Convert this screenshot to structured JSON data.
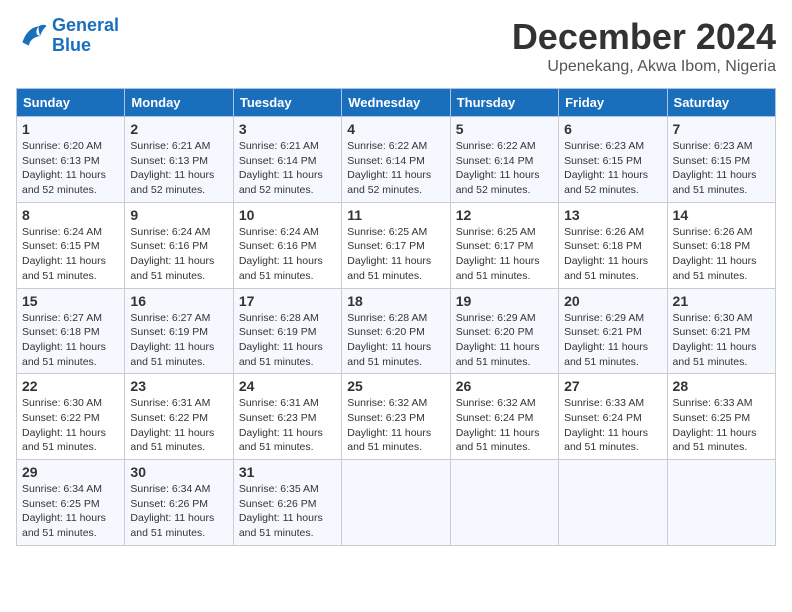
{
  "logo": {
    "line1": "General",
    "line2": "Blue"
  },
  "title": "December 2024",
  "location": "Upenekang, Akwa Ibom, Nigeria",
  "days_of_week": [
    "Sunday",
    "Monday",
    "Tuesday",
    "Wednesday",
    "Thursday",
    "Friday",
    "Saturday"
  ],
  "weeks": [
    [
      {
        "day": "1",
        "rise": "Sunrise: 6:20 AM",
        "set": "Sunset: 6:13 PM",
        "daylight": "Daylight: 11 hours and 52 minutes."
      },
      {
        "day": "2",
        "rise": "Sunrise: 6:21 AM",
        "set": "Sunset: 6:13 PM",
        "daylight": "Daylight: 11 hours and 52 minutes."
      },
      {
        "day": "3",
        "rise": "Sunrise: 6:21 AM",
        "set": "Sunset: 6:14 PM",
        "daylight": "Daylight: 11 hours and 52 minutes."
      },
      {
        "day": "4",
        "rise": "Sunrise: 6:22 AM",
        "set": "Sunset: 6:14 PM",
        "daylight": "Daylight: 11 hours and 52 minutes."
      },
      {
        "day": "5",
        "rise": "Sunrise: 6:22 AM",
        "set": "Sunset: 6:14 PM",
        "daylight": "Daylight: 11 hours and 52 minutes."
      },
      {
        "day": "6",
        "rise": "Sunrise: 6:23 AM",
        "set": "Sunset: 6:15 PM",
        "daylight": "Daylight: 11 hours and 52 minutes."
      },
      {
        "day": "7",
        "rise": "Sunrise: 6:23 AM",
        "set": "Sunset: 6:15 PM",
        "daylight": "Daylight: 11 hours and 51 minutes."
      }
    ],
    [
      {
        "day": "8",
        "rise": "Sunrise: 6:24 AM",
        "set": "Sunset: 6:15 PM",
        "daylight": "Daylight: 11 hours and 51 minutes."
      },
      {
        "day": "9",
        "rise": "Sunrise: 6:24 AM",
        "set": "Sunset: 6:16 PM",
        "daylight": "Daylight: 11 hours and 51 minutes."
      },
      {
        "day": "10",
        "rise": "Sunrise: 6:24 AM",
        "set": "Sunset: 6:16 PM",
        "daylight": "Daylight: 11 hours and 51 minutes."
      },
      {
        "day": "11",
        "rise": "Sunrise: 6:25 AM",
        "set": "Sunset: 6:17 PM",
        "daylight": "Daylight: 11 hours and 51 minutes."
      },
      {
        "day": "12",
        "rise": "Sunrise: 6:25 AM",
        "set": "Sunset: 6:17 PM",
        "daylight": "Daylight: 11 hours and 51 minutes."
      },
      {
        "day": "13",
        "rise": "Sunrise: 6:26 AM",
        "set": "Sunset: 6:18 PM",
        "daylight": "Daylight: 11 hours and 51 minutes."
      },
      {
        "day": "14",
        "rise": "Sunrise: 6:26 AM",
        "set": "Sunset: 6:18 PM",
        "daylight": "Daylight: 11 hours and 51 minutes."
      }
    ],
    [
      {
        "day": "15",
        "rise": "Sunrise: 6:27 AM",
        "set": "Sunset: 6:18 PM",
        "daylight": "Daylight: 11 hours and 51 minutes."
      },
      {
        "day": "16",
        "rise": "Sunrise: 6:27 AM",
        "set": "Sunset: 6:19 PM",
        "daylight": "Daylight: 11 hours and 51 minutes."
      },
      {
        "day": "17",
        "rise": "Sunrise: 6:28 AM",
        "set": "Sunset: 6:19 PM",
        "daylight": "Daylight: 11 hours and 51 minutes."
      },
      {
        "day": "18",
        "rise": "Sunrise: 6:28 AM",
        "set": "Sunset: 6:20 PM",
        "daylight": "Daylight: 11 hours and 51 minutes."
      },
      {
        "day": "19",
        "rise": "Sunrise: 6:29 AM",
        "set": "Sunset: 6:20 PM",
        "daylight": "Daylight: 11 hours and 51 minutes."
      },
      {
        "day": "20",
        "rise": "Sunrise: 6:29 AM",
        "set": "Sunset: 6:21 PM",
        "daylight": "Daylight: 11 hours and 51 minutes."
      },
      {
        "day": "21",
        "rise": "Sunrise: 6:30 AM",
        "set": "Sunset: 6:21 PM",
        "daylight": "Daylight: 11 hours and 51 minutes."
      }
    ],
    [
      {
        "day": "22",
        "rise": "Sunrise: 6:30 AM",
        "set": "Sunset: 6:22 PM",
        "daylight": "Daylight: 11 hours and 51 minutes."
      },
      {
        "day": "23",
        "rise": "Sunrise: 6:31 AM",
        "set": "Sunset: 6:22 PM",
        "daylight": "Daylight: 11 hours and 51 minutes."
      },
      {
        "day": "24",
        "rise": "Sunrise: 6:31 AM",
        "set": "Sunset: 6:23 PM",
        "daylight": "Daylight: 11 hours and 51 minutes."
      },
      {
        "day": "25",
        "rise": "Sunrise: 6:32 AM",
        "set": "Sunset: 6:23 PM",
        "daylight": "Daylight: 11 hours and 51 minutes."
      },
      {
        "day": "26",
        "rise": "Sunrise: 6:32 AM",
        "set": "Sunset: 6:24 PM",
        "daylight": "Daylight: 11 hours and 51 minutes."
      },
      {
        "day": "27",
        "rise": "Sunrise: 6:33 AM",
        "set": "Sunset: 6:24 PM",
        "daylight": "Daylight: 11 hours and 51 minutes."
      },
      {
        "day": "28",
        "rise": "Sunrise: 6:33 AM",
        "set": "Sunset: 6:25 PM",
        "daylight": "Daylight: 11 hours and 51 minutes."
      }
    ],
    [
      {
        "day": "29",
        "rise": "Sunrise: 6:34 AM",
        "set": "Sunset: 6:25 PM",
        "daylight": "Daylight: 11 hours and 51 minutes."
      },
      {
        "day": "30",
        "rise": "Sunrise: 6:34 AM",
        "set": "Sunset: 6:26 PM",
        "daylight": "Daylight: 11 hours and 51 minutes."
      },
      {
        "day": "31",
        "rise": "Sunrise: 6:35 AM",
        "set": "Sunset: 6:26 PM",
        "daylight": "Daylight: 11 hours and 51 minutes."
      },
      {
        "day": "",
        "rise": "",
        "set": "",
        "daylight": ""
      },
      {
        "day": "",
        "rise": "",
        "set": "",
        "daylight": ""
      },
      {
        "day": "",
        "rise": "",
        "set": "",
        "daylight": ""
      },
      {
        "day": "",
        "rise": "",
        "set": "",
        "daylight": ""
      }
    ]
  ]
}
